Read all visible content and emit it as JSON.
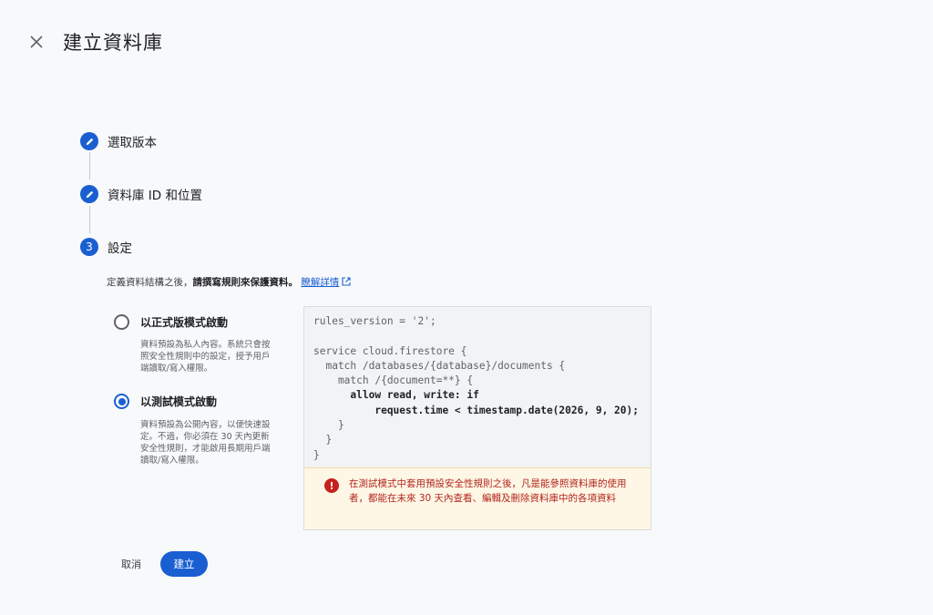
{
  "header": {
    "title": "建立資料庫",
    "close_icon": "close-icon"
  },
  "steps": [
    {
      "badge_icon": "pencil-icon",
      "label": "選取版本"
    },
    {
      "badge_icon": "pencil-icon",
      "label": "資料庫 ID 和位置"
    },
    {
      "number": "3",
      "label": "設定"
    }
  ],
  "settings": {
    "description_prefix": "定義資料結構之後，",
    "description_bold": "請撰寫規則來保護資料。",
    "learn_more_link": "瞭解詳情",
    "learn_more_icon": "external-link-icon",
    "options": [
      {
        "title": "以正式版模式啟動",
        "description": "資料預設為私人內容。系統只會按照安全性規則中的設定，授予用戶端讀取/寫入權限。",
        "checked": false
      },
      {
        "title": "以測試模式啟動",
        "description": "資料預設為公開內容，以便快速設定。不過，你必須在 30 天內更新安全性規則，才能啟用長期用戶端讀取/寫入權限。",
        "checked": true
      }
    ]
  },
  "rules_code": {
    "lines": [
      "rules_version = '2';",
      "",
      "service cloud.firestore {",
      "  match /databases/{database}/documents {",
      "    match /{document=**} {",
      "      allow read, write: if",
      "          request.time < timestamp.date(2026, 9, 20);",
      "    }",
      "  }",
      "}"
    ],
    "highlighted_lines": [
      5,
      6
    ]
  },
  "warning": {
    "icon": "error-icon",
    "text": "在測試模式中套用預設安全性規則之後，凡是能參照資料庫的使用者，都能在未來 30 天內查看、編輯及刪除資料庫中的各項資料"
  },
  "actions": {
    "cancel_label": "取消",
    "create_label": "建立"
  },
  "colors": {
    "accent": "#1a5fd1",
    "warning_text": "#b3261e",
    "warning_bg": "#fef7e6",
    "page_bg": "#f8f9fa"
  }
}
